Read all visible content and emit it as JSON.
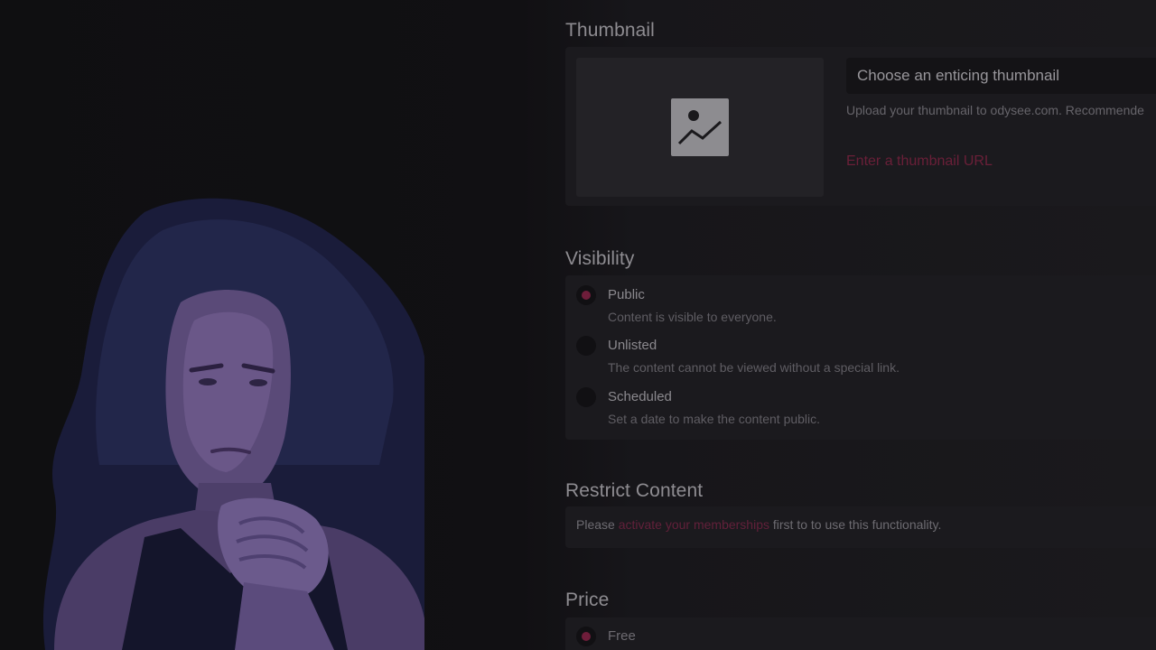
{
  "thumbnail": {
    "title": "Thumbnail",
    "input_text": "Choose an enticing thumbnail",
    "help_text": "Upload your thumbnail to odysee.com. Recommende",
    "url_link": "Enter a thumbnail URL",
    "icon": "image-icon"
  },
  "visibility": {
    "title": "Visibility",
    "options": [
      {
        "label": "Public",
        "description": "Content is visible to everyone.",
        "selected": true
      },
      {
        "label": "Unlisted",
        "description": "The content cannot be viewed without a special link.",
        "selected": false
      },
      {
        "label": "Scheduled",
        "description": "Set a date to make the content public.",
        "selected": false
      }
    ]
  },
  "restrict": {
    "title": "Restrict Content",
    "prefix": "Please ",
    "link": "activate your memberships",
    "suffix": " first to to use this functionality."
  },
  "price": {
    "title": "Price",
    "options": [
      {
        "label": "Free",
        "selected": true
      }
    ]
  },
  "colors": {
    "accent": "#6e1d3a",
    "background": "#111013",
    "card": "#1b1a1e"
  }
}
